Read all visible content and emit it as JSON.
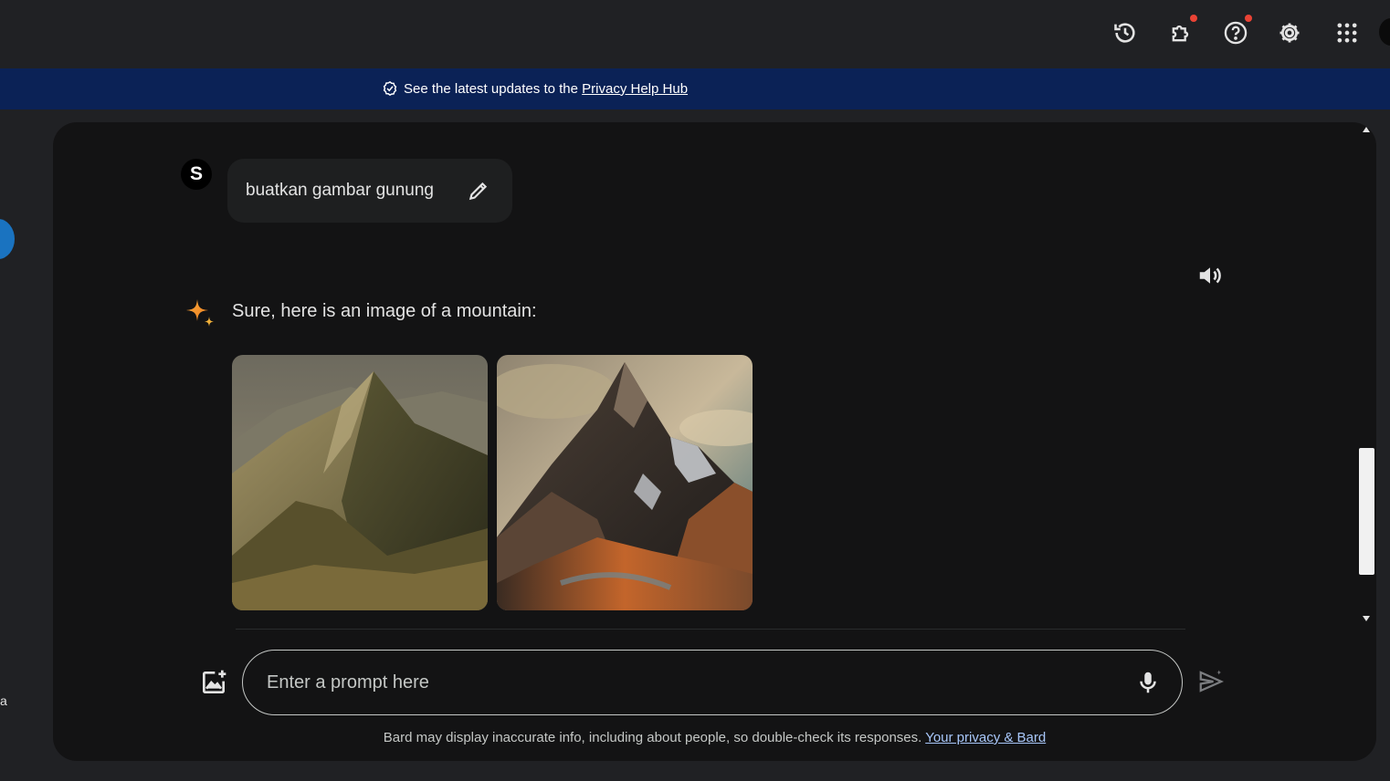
{
  "header": {
    "icons": [
      "history-icon",
      "extensions-icon",
      "help-icon",
      "settings-icon",
      "apps-grid-icon"
    ]
  },
  "banner": {
    "prefix": "See the latest updates to the",
    "link": "Privacy Help Hub"
  },
  "sidebar": {
    "edge_letter": "a"
  },
  "chat": {
    "user": {
      "avatar_letter": "S",
      "message": "buatkan gambar gunung"
    },
    "response": {
      "text": "Sure, here is an image of a mountain:",
      "images": [
        "mountain-image-1",
        "mountain-image-2"
      ]
    }
  },
  "input": {
    "placeholder": "Enter a prompt here"
  },
  "footer": {
    "disclaimer": "Bard may display inaccurate info, including about people, so double-check its responses.",
    "link": "Your privacy & Bard"
  },
  "colors": {
    "background": "#202124",
    "panel": "#131314",
    "banner": "#0b2256",
    "text": "#e3e3e3",
    "notification": "#ea4335"
  }
}
